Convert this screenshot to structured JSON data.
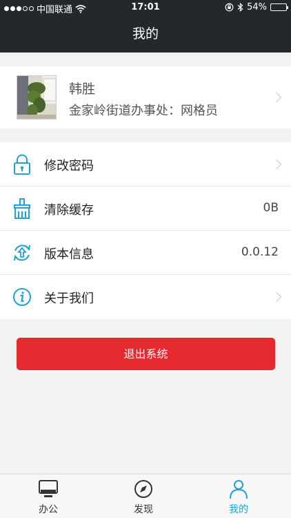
{
  "status_bar": {
    "carrier": "中国联通",
    "time": "17:01",
    "battery": "54%",
    "battery_level": 0.54
  },
  "nav": {
    "title": "我的"
  },
  "profile": {
    "name": "韩胜",
    "org_role": "金家岭街道办事处：网格员"
  },
  "menu": [
    {
      "label": "修改密码",
      "icon": "lock-icon",
      "value": "",
      "has_chevron": true
    },
    {
      "label": "清除缓存",
      "icon": "brush-icon",
      "value": "0B",
      "has_chevron": false
    },
    {
      "label": "版本信息",
      "icon": "update-icon",
      "value": "0.0.12",
      "has_chevron": false
    },
    {
      "label": "关于我们",
      "icon": "info-icon",
      "value": "",
      "has_chevron": true
    }
  ],
  "logout_label": "退出系统",
  "tabs": [
    {
      "label": "办公",
      "icon": "monitor-icon",
      "active": false
    },
    {
      "label": "发现",
      "icon": "compass-icon",
      "active": false
    },
    {
      "label": "我的",
      "icon": "person-icon",
      "active": true
    }
  ],
  "colors": {
    "header_bg": "#25282b",
    "accent": "#1da1d8",
    "logout_red": "#e52a2f"
  }
}
